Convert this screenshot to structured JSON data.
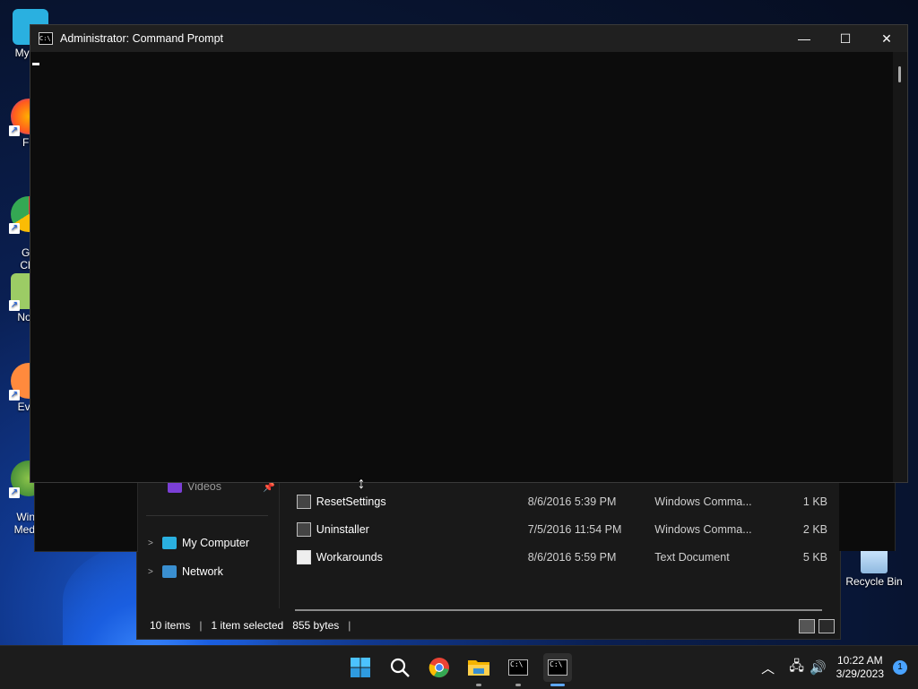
{
  "desktop": {
    "icons": [
      {
        "label": "My Co"
      },
      {
        "label": "Fir"
      },
      {
        "label": "Go\nChr"
      },
      {
        "label": "Note"
      },
      {
        "label": "Ever"
      },
      {
        "label": "Wind\nMedia"
      },
      {
        "label": "Recycle Bin"
      }
    ]
  },
  "cmd": {
    "title": "Administrator: Command Prompt",
    "controls": {
      "minimize": "—",
      "maximize": "☐",
      "close": "✕"
    }
  },
  "explorer": {
    "nav": {
      "videos": "Videos",
      "my_computer": "My Computer",
      "network": "Network"
    },
    "files": [
      {
        "name": "ResetSettings",
        "date": "8/6/2016 5:39 PM",
        "type": "Windows Comma...",
        "size": "1 KB"
      },
      {
        "name": "Uninstaller",
        "date": "7/5/2016 11:54 PM",
        "type": "Windows Comma...",
        "size": "2 KB"
      },
      {
        "name": "Workarounds",
        "date": "8/6/2016 5:59 PM",
        "type": "Text Document",
        "size": "5 KB"
      }
    ],
    "status": {
      "items": "10 items",
      "selected": "1 item selected",
      "bytes": "855 bytes"
    }
  },
  "taskbar": {
    "clock_time": "10:22 AM",
    "clock_date": "3/29/2023",
    "notification_count": "1",
    "colors": {
      "accent": "#5ea8ff"
    }
  }
}
